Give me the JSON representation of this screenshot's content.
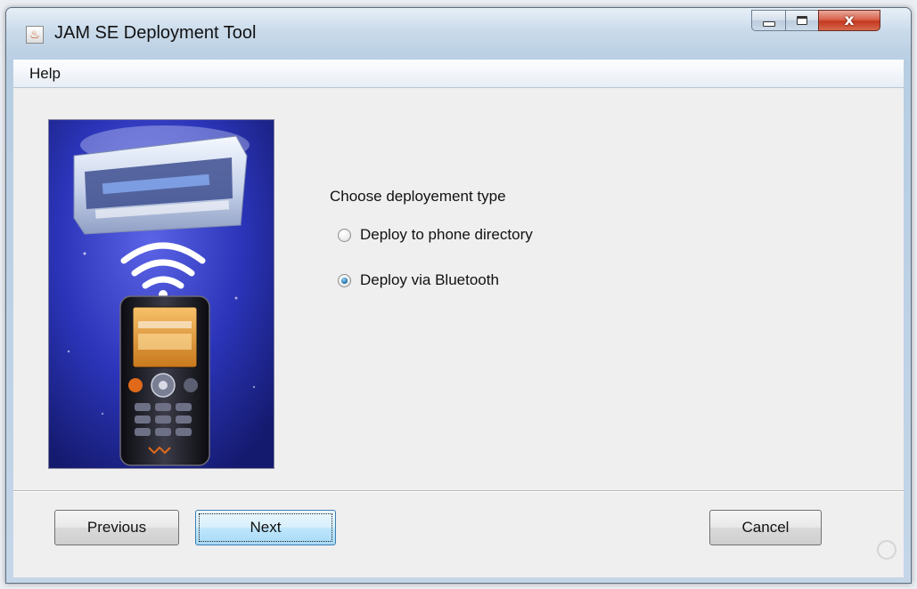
{
  "window": {
    "title": "JAM SE Deployment Tool",
    "close_glyph": "x",
    "icons": [
      "java-app-icon",
      "minimize-icon",
      "maximize-icon",
      "close-icon"
    ]
  },
  "menu": {
    "help_label": "Help"
  },
  "wizard": {
    "prompt": "Choose deployement type",
    "options": [
      {
        "label": "Deploy to phone directory",
        "selected": false
      },
      {
        "label": "Deploy via Bluetooth",
        "selected": true
      }
    ],
    "illustration": "phone-bluetooth-deployment-illustration"
  },
  "buttons": {
    "previous_label": "Previous",
    "next_label": "Next",
    "cancel_label": "Cancel"
  },
  "colors": {
    "illustration_bg": "#2b34b8",
    "radio_selected": "#2a7fb8",
    "default_button": "#bee6fd"
  }
}
